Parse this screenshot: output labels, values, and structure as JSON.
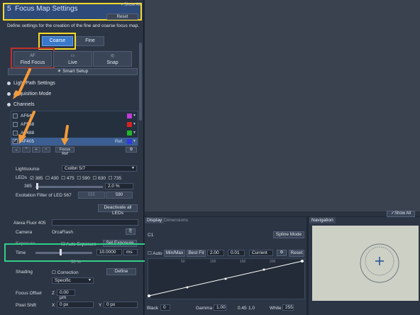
{
  "left_panel": {
    "section_number": "5",
    "section_title": "Focus Map Settings",
    "show_all_label": "Show All",
    "reset_label": "Reset",
    "description": "Define settings for the creation of the fine and coarse focus map.",
    "tabs": [
      {
        "label": "Coarse",
        "active": true
      },
      {
        "label": "Fine",
        "active": false
      }
    ],
    "action_buttons": [
      {
        "icon": "AF",
        "label": "Find Focus"
      },
      {
        "icon": "live-icon",
        "label": "Live"
      },
      {
        "icon": "camera-icon",
        "label": "Snap"
      }
    ],
    "smart_setup_label": "Smart Setup",
    "groups": {
      "light_path": "Light Path Settings",
      "acquisition": "Acquisition Mode",
      "channels": "Channels"
    },
    "channels": [
      {
        "name": "AF647",
        "color": "#c33ad6",
        "checked": false,
        "selected": false,
        "suffix": ""
      },
      {
        "name": "AF568",
        "color": "#d92222",
        "checked": false,
        "selected": false,
        "suffix": ""
      },
      {
        "name": "AF488",
        "color": "#22b62a",
        "checked": false,
        "selected": false,
        "suffix": ""
      },
      {
        "name": "AF405",
        "color": "#3239e0",
        "checked": true,
        "selected": true,
        "suffix": "Ref."
      }
    ],
    "focus_ref_label": "Focus Ref",
    "lightsource": {
      "label": "Lightsource",
      "value": "Colibri 5/7"
    },
    "leds": {
      "label": "LEDs",
      "items": [
        {
          "value": "385",
          "checked": true
        },
        {
          "value": "430",
          "checked": false
        },
        {
          "value": "475",
          "checked": false
        },
        {
          "value": "590",
          "checked": false
        },
        {
          "value": "630",
          "checked": false
        },
        {
          "value": "735",
          "checked": false
        }
      ]
    },
    "led_power": {
      "wavelength": "385",
      "value": "2.0 %"
    },
    "excitation": {
      "label": "Excitation Filter of LED 567",
      "options": [
        "555",
        "590"
      ]
    },
    "deactivate_label": "Deactivate all LEDs",
    "channel_name": "Alexa Fluor 405",
    "camera": {
      "label": "Camera",
      "value": "OrcaFlash"
    },
    "exposure": {
      "label": "Exposure",
      "auto_label": "Auto Exposure",
      "set_label": "Set Exposure"
    },
    "time": {
      "label": "Time",
      "value": "10.0000",
      "unit": "ms"
    },
    "snap_value": "50 %",
    "shading": {
      "label": "Shading",
      "correction_label": "Correction",
      "define_label": "Define",
      "mode": "Specific"
    },
    "focus_offset": {
      "label": "Focus Offset",
      "axis": "Z",
      "value": "0.00 µm"
    },
    "pixel_shift": {
      "label": "Pixel Shift",
      "x_label": "X",
      "x_value": "0 px",
      "y_label": "Y",
      "y_value": "0 px"
    }
  },
  "right_panels": {
    "show_all_label": "Show All",
    "display_tabs": [
      {
        "label": "Display",
        "active": true
      },
      {
        "label": "Dimensions",
        "active": false
      }
    ],
    "channel": "C1",
    "spline_mode_label": "Spline Mode",
    "controls": {
      "auto_label": "Auto",
      "minmax_label": "Min/Max",
      "bestfit_label": "Best Fit",
      "value1": "2.00",
      "value2": "0.01",
      "current_label": "Current",
      "reset_label": "Reset"
    },
    "curve_ticks": [
      "50",
      "100",
      "150",
      "200"
    ],
    "bottom": {
      "black_label": "Black",
      "black_value": "0",
      "gamma_label": "Gamma",
      "gamma_value": "1.00",
      "gamma_min": "0.45",
      "gamma_max": "1.0",
      "white_label": "White",
      "white_value": "255"
    },
    "nav_tab": "Navigation"
  }
}
